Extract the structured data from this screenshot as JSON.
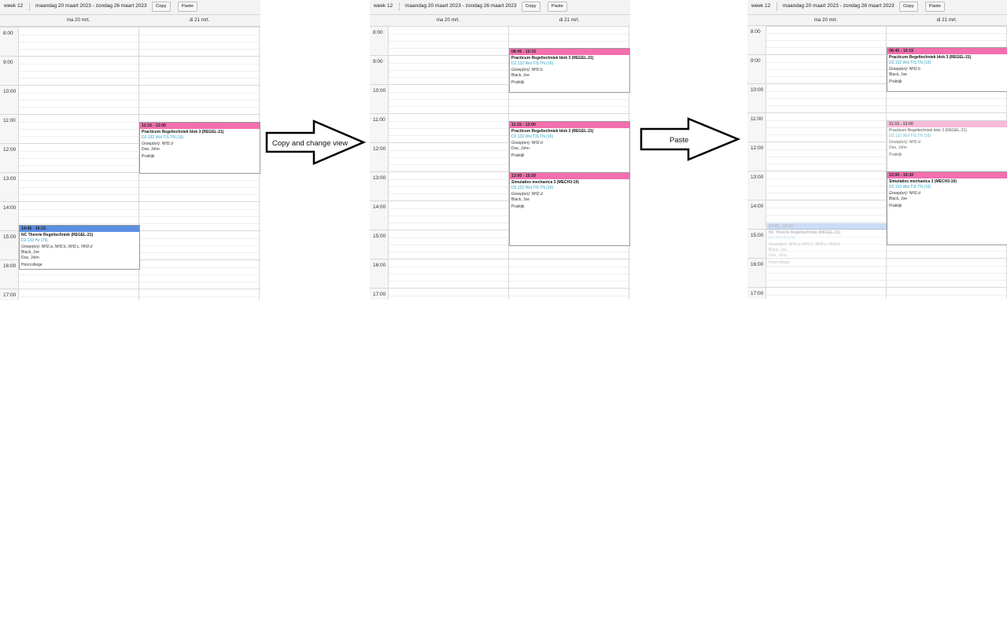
{
  "toolbar": {
    "week": "week 12",
    "range": "maandag 20 maart 2023 - zondag 26 maart 2023",
    "copy": "Copy",
    "paste": "Paste"
  },
  "days": [
    "ma 20 mrt.",
    "di 21 mrt."
  ],
  "hours": [
    "8:00",
    "9:00",
    "10:00",
    "11:00",
    "12:00",
    "13:00",
    "14:00",
    "15:00",
    "16:00",
    "17:00"
  ],
  "arrows": {
    "first": "Copy and change view",
    "second": "Paste"
  },
  "colors": {
    "pink": "#f36fae",
    "blue": "#5c8fe3",
    "room": "#2a9dbd"
  },
  "events": {
    "nc": {
      "time": "14:45 - 16:15",
      "title": "NC Theorie Regeltechniek (REGEL-21)",
      "room": "D2.133 Hz (75)",
      "groups": "Groep(en): NH2.a, NH2.b, NH2.c, NH2.d",
      "teachers": "Black, Joe\nDoe, John",
      "type": "Hoorcollege"
    },
    "prac1": {
      "time": "11:15 - 13:00",
      "title": "Practicum Regeltechniek blok 3 (REGEL-21)",
      "room": "D2.132 Wsl TIS TN (16)",
      "groups": "Groep(en): NH2.d",
      "teacher": "Doe, John",
      "type": "Praktijk"
    },
    "prac_morning": {
      "time": "08:45 - 10:15",
      "title": "Practicum Regeltechniek blok 3 (REGEL-21)",
      "room": "D2.132 Wsl TIS TN (16)",
      "groups": "Groep(en): NH2.b",
      "teacher": "Black, Joe",
      "type": "Praktijk"
    },
    "sim": {
      "time": "13:00 - 15:30",
      "title": "Simulaties mechanica 3 (MECH3-19)",
      "room": "D2.132 Wsl TIS TN (16)",
      "groups": "Groep(en): NH2.d",
      "teacher": "Black, Joe",
      "type": "Praktijk"
    }
  }
}
